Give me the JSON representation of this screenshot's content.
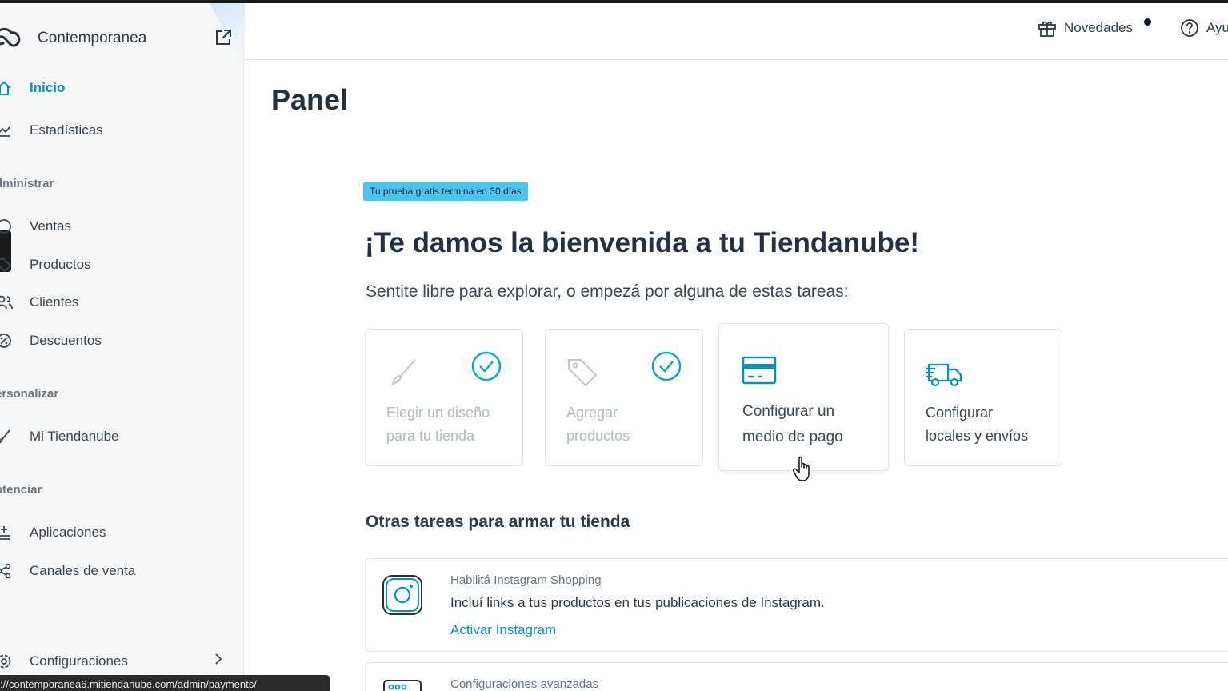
{
  "sidebar": {
    "brand_name": "Contemporanea",
    "items_main": [
      {
        "label": "Inicio",
        "icon": "home-icon",
        "active": true
      },
      {
        "label": "Estadísticas",
        "icon": "chart-icon",
        "active": false
      }
    ],
    "section_admin": "dministrar",
    "items_admin": [
      {
        "label": "Ventas",
        "icon": "sales-icon"
      },
      {
        "label": "Productos",
        "icon": "tag-icon"
      },
      {
        "label": "Clientes",
        "icon": "users-icon"
      },
      {
        "label": "Descuentos",
        "icon": "discount-icon"
      }
    ],
    "section_custom": "ersonalizar",
    "items_custom": [
      {
        "label": "Mi Tiendanube",
        "icon": "brush-icon"
      }
    ],
    "section_boost": "otenciar",
    "items_boost": [
      {
        "label": "Aplicaciones",
        "icon": "apps-icon"
      },
      {
        "label": "Canales de venta",
        "icon": "share-icon"
      }
    ],
    "settings_label": "Configuraciones"
  },
  "header": {
    "news_label": "Novedades",
    "help_label": "Ayu"
  },
  "main": {
    "page_title": "Panel",
    "trial_badge": "Tu prueba gratis termina en 30 días",
    "welcome": "¡Te damos la bienvenida a tu Tiendanube!",
    "subtitle": "Sentite libre para explorar, o empezá por alguna de estas tareas:",
    "tasks": [
      {
        "line1": "Elegir un diseño",
        "line2": "para tu tienda",
        "done": true,
        "icon": "brush-icon"
      },
      {
        "line1": "Agregar",
        "line2": "productos",
        "done": true,
        "icon": "tag-icon"
      },
      {
        "line1": "Configurar un",
        "line2": "medio de pago",
        "done": false,
        "icon": "credit-card-icon"
      },
      {
        "line1": "Configurar",
        "line2": "locales y envíos",
        "done": false,
        "icon": "truck-icon"
      }
    ],
    "other_title": "Otras tareas para armar tu tienda",
    "instagram_card": {
      "kicker": "Habilitá Instagram Shopping",
      "description": "Incluí links a tus productos en tus publicaciones de Instagram.",
      "link": "Activar Instagram"
    },
    "advanced_card": {
      "kicker": "Configuraciones avanzadas"
    }
  },
  "status_bar": {
    "url": "://contemporanea6.mitiendanube.com/admin/payments/"
  },
  "colors": {
    "accent": "#0a91b8",
    "badge": "#4cc3f0",
    "sidebar_bg": "#f6f6f6",
    "check": "#13a8b8"
  }
}
